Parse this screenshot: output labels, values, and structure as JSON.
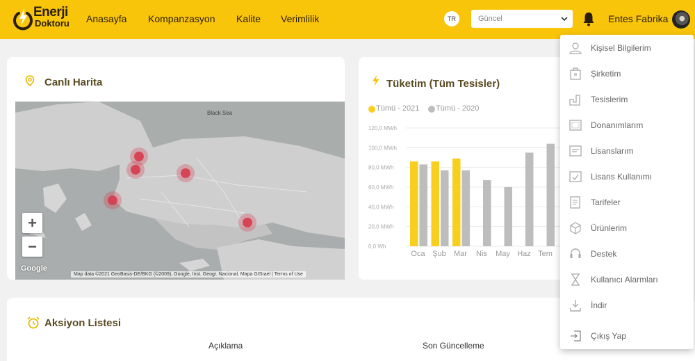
{
  "app": {
    "logo_line1": "Enerji",
    "logo_line2": "Doktoru"
  },
  "nav": [
    "Anasayfa",
    "Kompanzasyon",
    "Kalite",
    "Verimlilik"
  ],
  "header": {
    "language": "TR",
    "period_select": "Güncel",
    "username": "Entes Fabrika"
  },
  "map_card": {
    "title": "Canlı Harita",
    "sea_label": "Black Sea",
    "zoom_in": "+",
    "zoom_out": "−",
    "google": "Google",
    "attribution": "Map data ©2021 GeoBasis-DE/BKG (©2009), Google, Inst. Geogr. Nacional, Mapa GISrael  |  Terms of Use"
  },
  "chart_card": {
    "title": "Tüketim (Tüm Tesisler)"
  },
  "chart_data": {
    "type": "bar",
    "title": "Tüketim (Tüm Tesisler)",
    "categories": [
      "Oca",
      "Şub",
      "Mar",
      "Nis",
      "May",
      "Haz",
      "Tem"
    ],
    "series": [
      {
        "name": "Tümü - 2021",
        "color": "#f9cf1f",
        "values": [
          86,
          86,
          89,
          null,
          null,
          null,
          null
        ]
      },
      {
        "name": "Tümü - 2020",
        "color": "#bdbdbd",
        "values": [
          83,
          77,
          77,
          67,
          60,
          95,
          104
        ]
      }
    ],
    "ylim": [
      0,
      120
    ],
    "yticks": [
      "0,0 Wh",
      "20,0 MWh",
      "40,0 MWh",
      "60,0 MWh",
      "80,0 MWh",
      "100,0 MWh",
      "120,0 MWh"
    ],
    "grid": true,
    "legend": "top-left"
  },
  "actions_card": {
    "title": "Aksiyon Listesi",
    "columns": [
      "Açıklama",
      "Son Güncelleme"
    ]
  },
  "user_menu": [
    {
      "label": "Kişisel Bilgilerim",
      "icon": "user-icon"
    },
    {
      "label": "Şirketim",
      "icon": "building-icon"
    },
    {
      "label": "Tesislerim",
      "icon": "factory-icon"
    },
    {
      "label": "Donanımlarım",
      "icon": "device-icon"
    },
    {
      "label": "Lisanslarım",
      "icon": "license-icon"
    },
    {
      "label": "Lisans Kullanımı",
      "icon": "license-usage-icon"
    },
    {
      "label": "Tarifeler",
      "icon": "tariff-icon"
    },
    {
      "label": "Ürünlerim",
      "icon": "products-icon"
    },
    {
      "label": "Destek",
      "icon": "headset-icon"
    },
    {
      "label": "Kullanıcı Alarmları",
      "icon": "hourglass-icon"
    },
    {
      "label": "İndir",
      "icon": "download-icon"
    },
    {
      "label": "Çıkış Yap",
      "icon": "logout-icon"
    }
  ],
  "colors": {
    "brand": "#f9c50a",
    "marker": "#d63d4f",
    "series_2021": "#f9cf1f",
    "series_2020": "#bdbdbd"
  }
}
